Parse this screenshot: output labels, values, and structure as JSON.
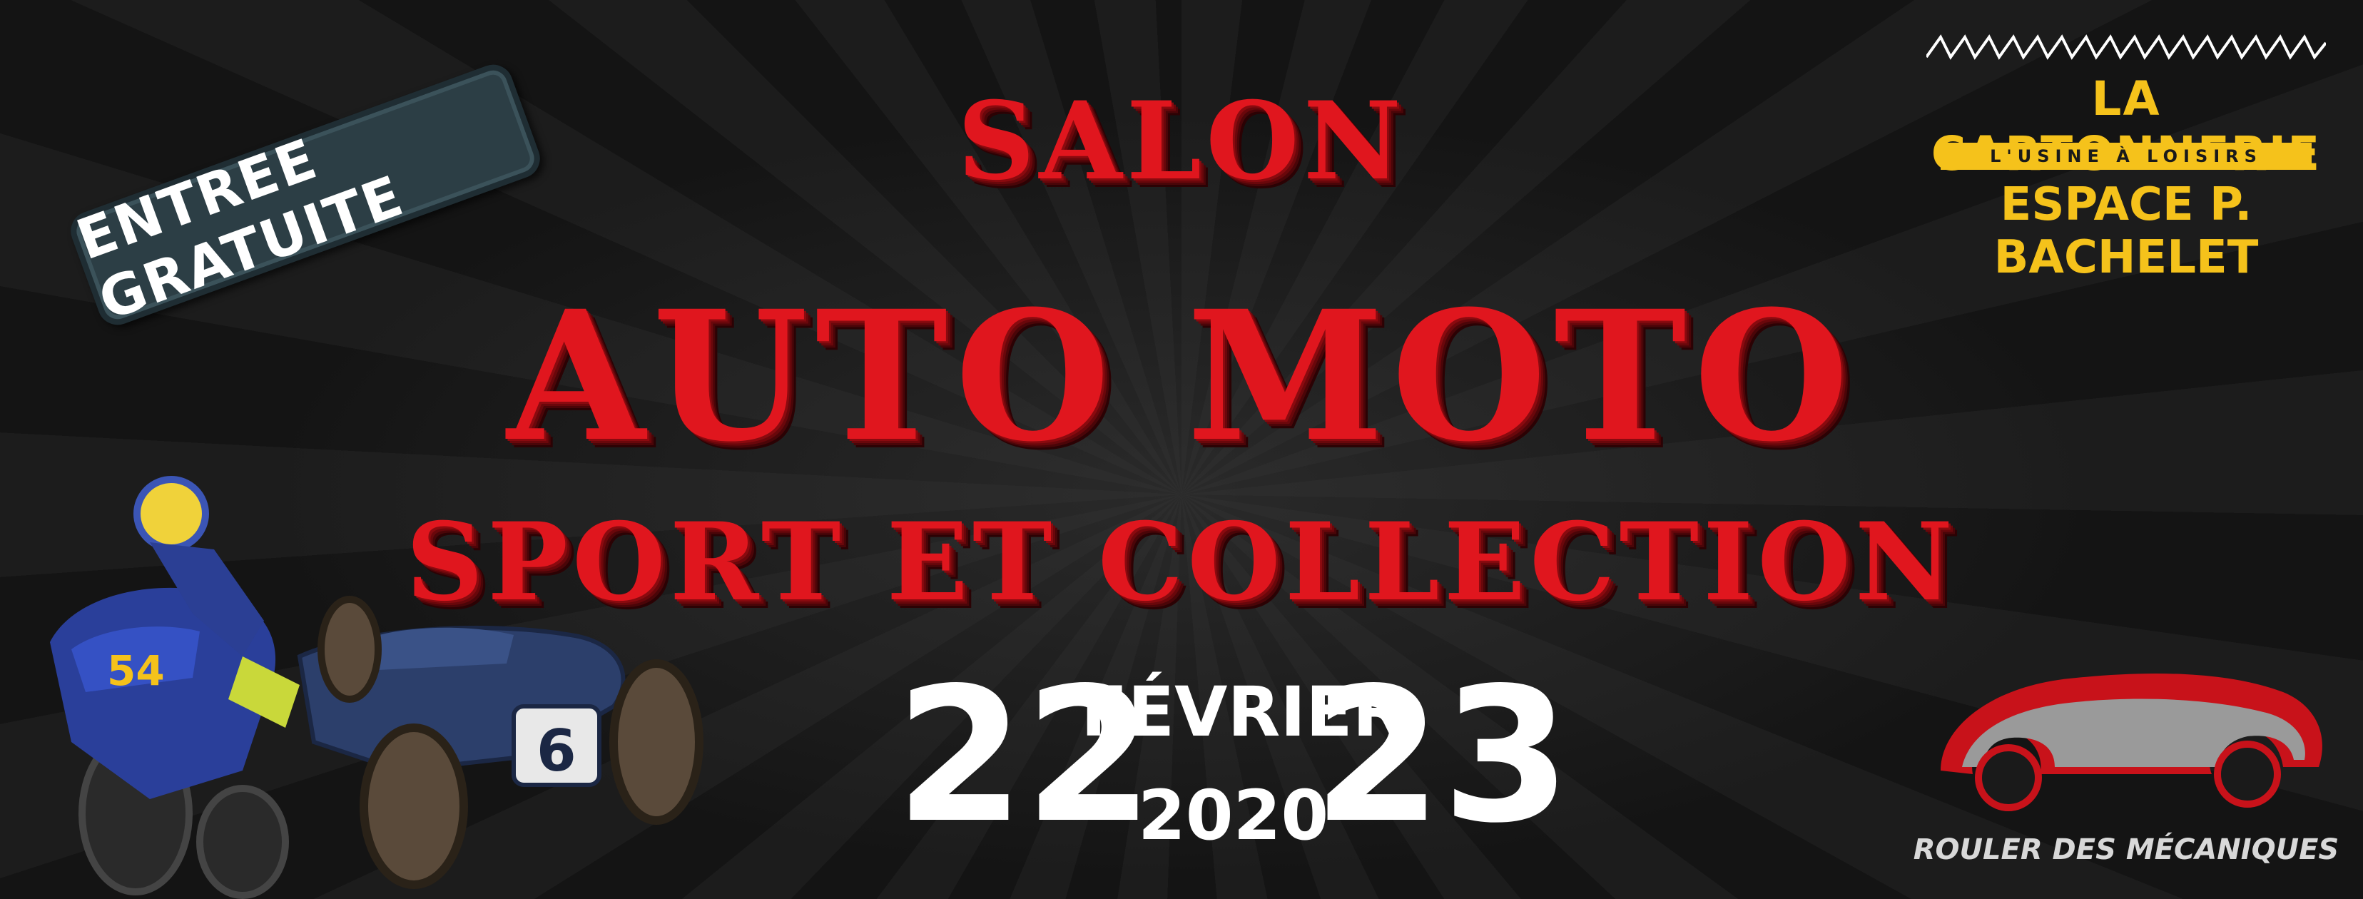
{
  "badge": {
    "text": "ENTREE GRATUITE"
  },
  "title": {
    "line1": "SALON",
    "line2": "AUTO MOTO",
    "line3": "SPORT ET COLLECTION"
  },
  "dates": {
    "day_start": "22",
    "month": "FÉVRIER",
    "year": "2020",
    "day_end": "23"
  },
  "venue": {
    "name": "LA CARTONNERIE",
    "tagline": "L'USINE À LOISIRS",
    "place": "ESPACE P. BACHELET"
  },
  "organizer": {
    "name": "ROULER DES MÉCANIQUES"
  },
  "illustration": {
    "moto_number": "54",
    "car_number": "6"
  },
  "colors": {
    "title_red": "#e0161e",
    "venue_yellow": "#f5c21b",
    "badge_teal": "#2c3e45",
    "background": "#161616"
  }
}
